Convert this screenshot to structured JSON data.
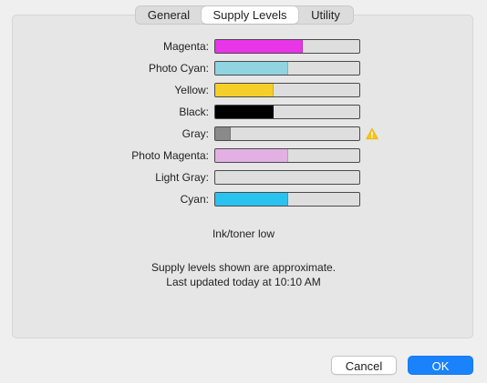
{
  "tabs": [
    {
      "label": "General",
      "active": false
    },
    {
      "label": "Supply Levels",
      "active": true
    },
    {
      "label": "Utility",
      "active": false
    }
  ],
  "supplies": [
    {
      "label": "Magenta:",
      "level_percent": 60,
      "color": "#e835e8",
      "warning": false
    },
    {
      "label": "Photo Cyan:",
      "level_percent": 50,
      "color": "#8fd4e0",
      "warning": false
    },
    {
      "label": "Yellow:",
      "level_percent": 40,
      "color": "#f4cf2a",
      "warning": false
    },
    {
      "label": "Black:",
      "level_percent": 40,
      "color": "#000000",
      "warning": false
    },
    {
      "label": "Gray:",
      "level_percent": 10,
      "color": "#8a8a8a",
      "warning": true
    },
    {
      "label": "Photo Magenta:",
      "level_percent": 50,
      "color": "#e3b0e4",
      "warning": false
    },
    {
      "label": "Light Gray:",
      "level_percent": 0,
      "color": "#c8c8c8",
      "warning": false
    },
    {
      "label": "Cyan:",
      "level_percent": 50,
      "color": "#2ac3f0",
      "warning": false
    }
  ],
  "warning_color": "#f5c518",
  "status": {
    "low_message": "Ink/toner low",
    "approximate_note": "Supply levels shown are approximate.",
    "last_updated": "Last updated today at 10:10 AM"
  },
  "buttons": {
    "cancel_label": "Cancel",
    "ok_label": "OK"
  }
}
